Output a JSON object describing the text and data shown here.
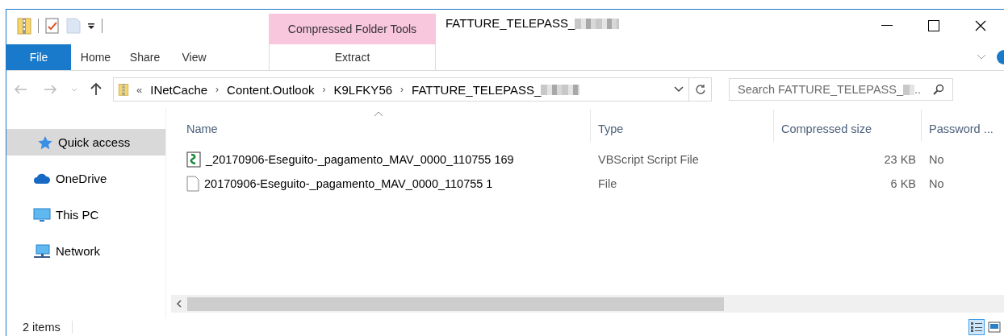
{
  "window": {
    "title": "FATTURE_TELEPASS_",
    "title_redacted": true
  },
  "quick_access_toolbar": [
    {
      "kind": "folder"
    },
    {
      "kind": "properties"
    },
    {
      "kind": "newfolder"
    },
    {
      "kind": "customize"
    }
  ],
  "contextual_group": {
    "label": "Compressed Folder Tools"
  },
  "ribbon_tabs": [
    {
      "label": "File",
      "kind": "file"
    },
    {
      "label": "Home",
      "kind": "plain"
    },
    {
      "label": "Share",
      "kind": "plain"
    },
    {
      "label": "View",
      "kind": "plain"
    },
    {
      "label": "Extract",
      "kind": "contextual"
    }
  ],
  "address_bar": {
    "overflow": "«",
    "separator": "›",
    "crumbs": [
      {
        "label": "INetCache",
        "redacted": false
      },
      {
        "label": "Content.Outlook",
        "redacted": false
      },
      {
        "label": "K9LFKY56",
        "redacted": false
      },
      {
        "label": "FATTURE_TELEPASS_",
        "redacted": true
      }
    ]
  },
  "search": {
    "placeholder": "Search FATTURE_TELEPASS_",
    "redacted": true,
    "ellipsis": ".."
  },
  "sidebar": {
    "items": [
      {
        "label": "Quick access",
        "kind": "star",
        "selected": true
      },
      {
        "label": "OneDrive",
        "kind": "cloud",
        "selected": false
      },
      {
        "label": "This PC",
        "kind": "pc",
        "selected": false
      },
      {
        "label": "Network",
        "kind": "network",
        "selected": false
      }
    ]
  },
  "table": {
    "columns": [
      {
        "label": "Name",
        "sorted": true,
        "kind": "text"
      },
      {
        "label": "Type",
        "sorted": false,
        "kind": "text"
      },
      {
        "label": "Compressed size",
        "sorted": false,
        "kind": "number"
      },
      {
        "label": "Password ...",
        "sorted": false,
        "kind": "text"
      }
    ],
    "rows": [
      {
        "kind": "script",
        "cells": [
          "_20170906-Eseguito-_pagamento_MAV_0000_110755 169",
          "VBScript Script File",
          "23 KB",
          "No"
        ]
      },
      {
        "kind": "file",
        "cells": [
          "20170906-Eseguito-_pagamento_MAV_0000_110755 1",
          "File",
          "6 KB",
          "No"
        ]
      }
    ]
  },
  "status_bar": {
    "text": "2 items",
    "views": [
      {
        "kind": "details",
        "selected": true
      },
      {
        "kind": "large",
        "selected": false
      }
    ]
  }
}
